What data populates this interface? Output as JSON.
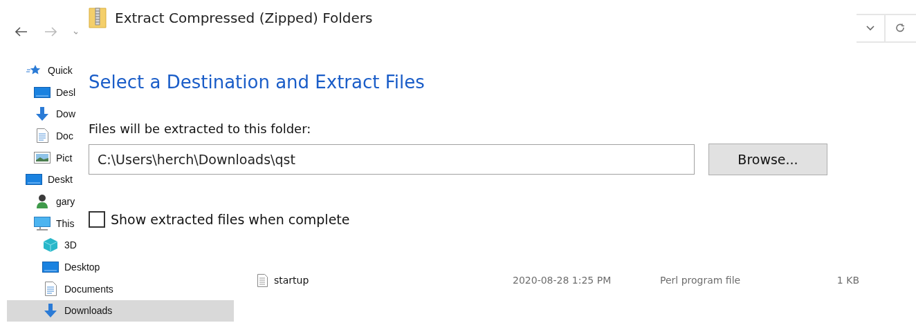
{
  "explorer": {
    "sidebar": {
      "items": [
        {
          "label": "Quick",
          "selected": false,
          "children": [
            {
              "label": "Desl",
              "selected": false
            },
            {
              "label": "Dow",
              "selected": false
            },
            {
              "label": "Doc",
              "selected": false
            },
            {
              "label": "Pict",
              "selected": false
            }
          ]
        },
        {
          "label": "Deskt",
          "selected": false,
          "children": [
            {
              "label": "gary",
              "selected": false
            },
            {
              "label": "This",
              "selected": false,
              "children": [
                {
                  "label": "3D",
                  "selected": false
                },
                {
                  "label": "Desktop",
                  "selected": false
                },
                {
                  "label": "Documents",
                  "selected": false
                },
                {
                  "label": "Downloads",
                  "selected": true
                }
              ]
            }
          ]
        }
      ]
    },
    "files": [
      {
        "name": "startup",
        "date": "2020-08-28 1:25 PM",
        "type": "Perl program file",
        "size": "1 KB"
      }
    ]
  },
  "dialog": {
    "title": "Extract Compressed (Zipped) Folders",
    "heading": "Select a Destination and Extract Files",
    "folder_label": "Files will be extracted to this folder:",
    "folder_path": "C:\\Users\\herch\\Downloads\\qst",
    "browse_button": "Browse...",
    "checkbox": {
      "label": "Show extracted files when complete",
      "checked": false
    }
  }
}
